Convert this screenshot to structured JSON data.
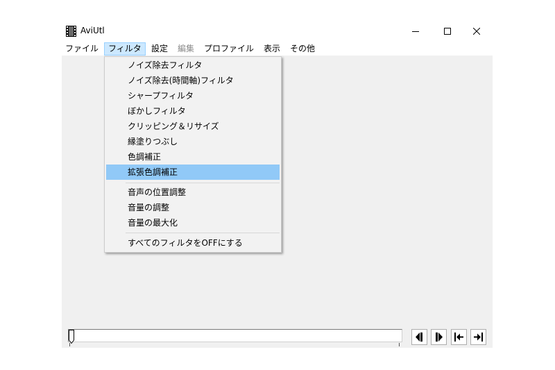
{
  "window": {
    "title": "AviUtl"
  },
  "menubar": {
    "items": [
      {
        "label": "ファイル"
      },
      {
        "label": "フィルタ"
      },
      {
        "label": "設定"
      },
      {
        "label": "編集"
      },
      {
        "label": "プロファイル"
      },
      {
        "label": "表示"
      },
      {
        "label": "その他"
      }
    ]
  },
  "filter_menu": {
    "items": [
      {
        "label": "ノイズ除去フィルタ"
      },
      {
        "label": "ノイズ除去(時間軸)フィルタ"
      },
      {
        "label": "シャープフィルタ"
      },
      {
        "label": "ぼかしフィルタ"
      },
      {
        "label": "クリッピング＆リサイズ"
      },
      {
        "label": "縁塗りつぶし"
      },
      {
        "label": "色調補正"
      },
      {
        "label": "拡張色調補正"
      },
      {
        "label": "音声の位置調整"
      },
      {
        "label": "音量の調整"
      },
      {
        "label": "音量の最大化"
      },
      {
        "label": "すべてのフィルタをOFFにする"
      }
    ],
    "highlighted": "拡張色調補正"
  },
  "colors": {
    "menu_active": "#cce8ff",
    "menu_highlight": "#91c9f7",
    "client_bg": "#f0f0f0",
    "disabled_text": "#8b8b8b"
  },
  "icons": {
    "app": "filmstrip-icon",
    "minimize": "minimize-icon",
    "maximize": "maximize-icon",
    "close": "close-icon",
    "nav": [
      "step-back-icon",
      "step-forward-icon",
      "jump-start-icon",
      "jump-end-icon"
    ]
  }
}
